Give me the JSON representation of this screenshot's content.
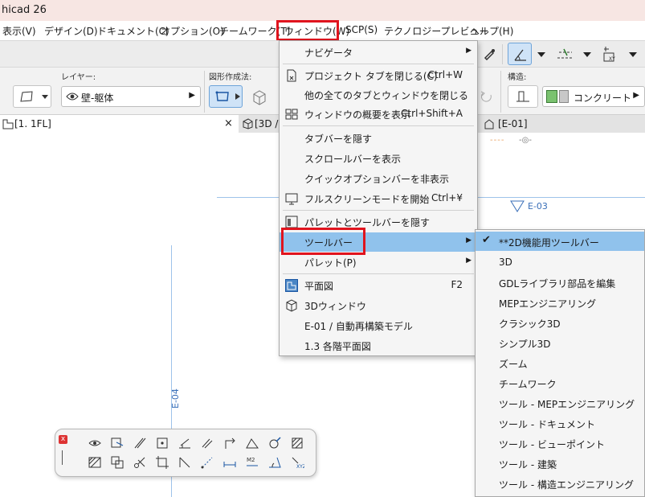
{
  "window": {
    "title": "hicad 26"
  },
  "menubar": {
    "items": [
      "表示(V)",
      "デザイン(D)",
      "ドキュメント(C)",
      "オプション(O)",
      "チームワーク(T)",
      "ウィンドウ(W)",
      "SCP(S)",
      "テクノロジープレビュー",
      "ヘルプ(H)"
    ]
  },
  "infobox": {
    "layer_label": "レイヤー:",
    "layer_value": "壁-躯体",
    "geometry_label": "図形作成法:",
    "structure_label": "構造:",
    "structure_value": "コンクリート"
  },
  "tabs": {
    "floor_plan": "[1. 1FL]",
    "close": "×",
    "view3d": "[3D /",
    "elevation": "[E-01]"
  },
  "canvas": {
    "grid_e03": "E-03",
    "grid_e04": "E-04",
    "dash_marker": "----",
    "eye_marker": "-◎-"
  },
  "window_menu": {
    "items": [
      {
        "label": "ナビゲータ",
        "shortcut": "",
        "submenu": true
      },
      {
        "label": "プロジェクト タブを閉じる(C)",
        "shortcut": "Ctrl+W",
        "submenu": false
      },
      {
        "label": "他の全てのタブとウィンドウを閉じる",
        "shortcut": "",
        "submenu": false
      },
      {
        "label": "ウィンドウの概要を表示",
        "shortcut": "Ctrl+Shift+A",
        "submenu": false
      },
      {
        "label": "タブバーを隠す",
        "shortcut": "",
        "submenu": false
      },
      {
        "label": "スクロールバーを表示",
        "shortcut": "",
        "submenu": false
      },
      {
        "label": "クイックオプションバーを非表示",
        "shortcut": "",
        "submenu": false
      },
      {
        "label": "フルスクリーンモードを開始",
        "shortcut": "Ctrl+¥",
        "submenu": false
      },
      {
        "label": "パレットとツールバーを隠す",
        "shortcut": "",
        "submenu": false
      },
      {
        "label": "ツールバー",
        "shortcut": "",
        "submenu": true
      },
      {
        "label": "パレット(P)",
        "shortcut": "",
        "submenu": true
      },
      {
        "label": "平面図",
        "shortcut": "F2",
        "submenu": false
      },
      {
        "label": "3Dウィンドウ",
        "shortcut": "",
        "submenu": false
      },
      {
        "label": "E-01 / 自動再構築モデル",
        "shortcut": "",
        "submenu": false
      },
      {
        "label": "1.3 各階平面図",
        "shortcut": "",
        "submenu": false
      }
    ]
  },
  "toolbar_submenu": {
    "checkmark": "✔",
    "items": [
      "**2D機能用ツールバー",
      "3D",
      "GDLライブラリ部品を編集",
      "MEPエンジニアリング",
      "クラシック3D",
      "シンプル3D",
      "ズーム",
      "チームワーク",
      "ツール - MEPエンジニアリング",
      "ツール - ドキュメント",
      "ツール - ビューポイント",
      "ツール - 建築",
      "ツール - 構造エンジニアリング"
    ]
  },
  "palette": {
    "close_label": "x"
  },
  "colors": {
    "highlight": "#90c2ec",
    "annotation_red": "#e0141e",
    "grid_blue": "#9ec3ea"
  }
}
